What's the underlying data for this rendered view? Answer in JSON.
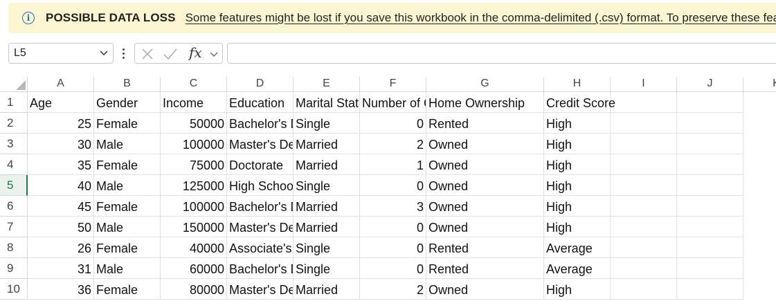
{
  "infobar": {
    "title": "POSSIBLE DATA LOSS",
    "message": "Some features might be lost if you save this workbook in the comma-delimited (.csv) format. To preserve these features, save it in an Excel file format."
  },
  "formula_bar": {
    "name_box": "L5",
    "fx_label": "fx",
    "formula": ""
  },
  "columns": [
    "A",
    "B",
    "C",
    "D",
    "E",
    "F",
    "G",
    "H",
    "I",
    "J",
    "K"
  ],
  "rows": [
    [
      "1",
      "Age",
      "Gender",
      "Income",
      "Education",
      "Marital Status",
      "Number of Children",
      "Home Ownership",
      "Credit Score",
      "",
      ""
    ],
    [
      "2",
      "25",
      "Female",
      "50000",
      "Bachelor's Degree",
      "Single",
      "0",
      "Rented",
      "High",
      "",
      ""
    ],
    [
      "3",
      "30",
      "Male",
      "100000",
      "Master's Degree",
      "Married",
      "2",
      "Owned",
      "High",
      "",
      ""
    ],
    [
      "4",
      "35",
      "Female",
      "75000",
      "Doctorate",
      "Married",
      "1",
      "Owned",
      "High",
      "",
      ""
    ],
    [
      "5",
      "40",
      "Male",
      "125000",
      "High School Diploma",
      "Single",
      "0",
      "Owned",
      "High",
      "",
      ""
    ],
    [
      "6",
      "45",
      "Female",
      "100000",
      "Bachelor's Degree",
      "Married",
      "3",
      "Owned",
      "High",
      "",
      ""
    ],
    [
      "7",
      "50",
      "Male",
      "150000",
      "Master's Degree",
      "Married",
      "0",
      "Owned",
      "High",
      "",
      ""
    ],
    [
      "8",
      "26",
      "Female",
      "40000",
      "Associate's Degree",
      "Single",
      "0",
      "Rented",
      "Average",
      "",
      ""
    ],
    [
      "9",
      "31",
      "Male",
      "60000",
      "Bachelor's Degree",
      "Single",
      "0",
      "Rented",
      "Average",
      "",
      ""
    ],
    [
      "10",
      "36",
      "Female",
      "80000",
      "Master's Degree",
      "Married",
      "2",
      "Owned",
      "High",
      "",
      ""
    ]
  ],
  "active_row": "5",
  "colors": {
    "accent": "#217346",
    "info": "#1f6fbf",
    "infobar_bg": "#fdf6d3"
  }
}
